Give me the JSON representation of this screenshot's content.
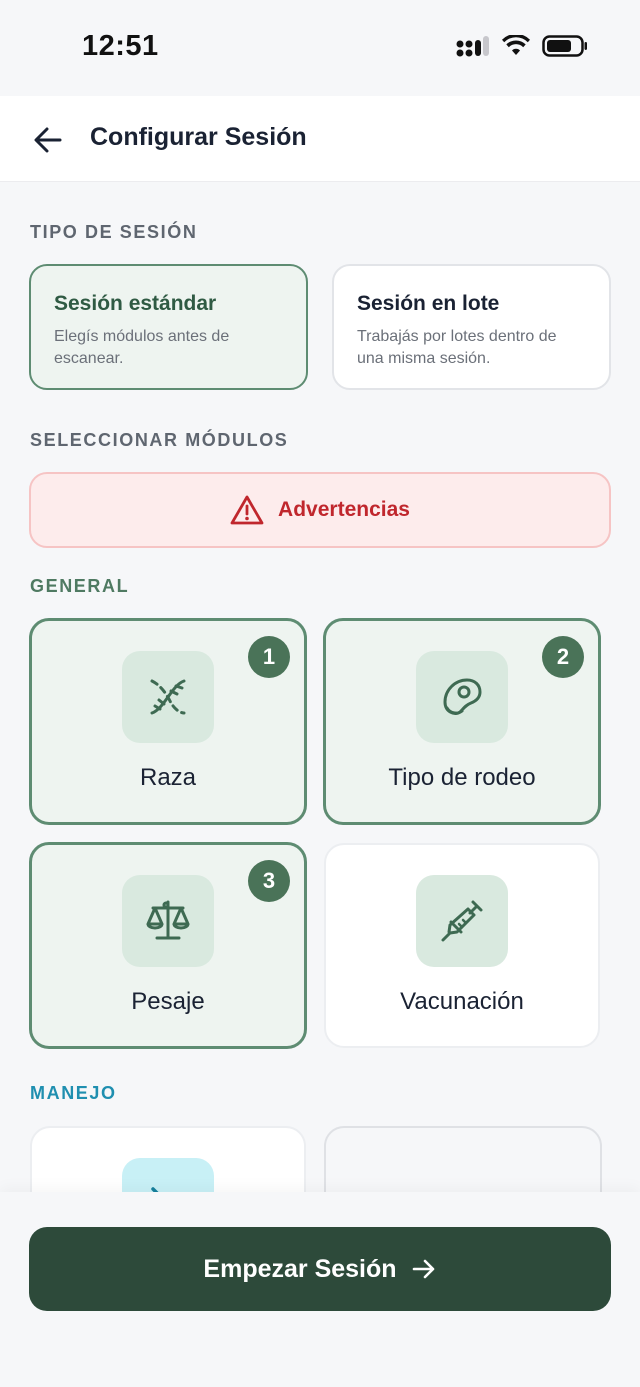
{
  "status_bar": {
    "time": "12:51"
  },
  "header": {
    "title": "Configurar Sesión",
    "back_icon": "arrow-left-icon"
  },
  "session_type": {
    "section_label": "TIPO DE SESIÓN",
    "options": [
      {
        "title": "Sesión estándar",
        "description": "Elegís módulos antes de escanear.",
        "selected": true
      },
      {
        "title": "Sesión en lote",
        "description": "Trabajás por lotes dentro de una misma sesión.",
        "selected": false
      }
    ]
  },
  "modules_section": {
    "label": "SELECCIONAR MÓDULOS"
  },
  "warning": {
    "label": "Advertencias",
    "icon": "warning-triangle-icon",
    "color": "#c0272d"
  },
  "groups": {
    "general": {
      "label": "GENERAL",
      "color": "#4f7a62",
      "modules": [
        {
          "label": "Raza",
          "icon": "dna-icon",
          "selected": true,
          "order": "1"
        },
        {
          "label": "Tipo de rodeo",
          "icon": "meat-steak-icon",
          "selected": true,
          "order": "2"
        },
        {
          "label": "Pesaje",
          "icon": "scale-icon",
          "selected": true,
          "order": "3"
        },
        {
          "label": "Vacunación",
          "icon": "syringe-icon",
          "selected": false
        }
      ]
    },
    "manejo": {
      "label": "MANEJO",
      "color": "#1f8fb0",
      "modules": [
        {
          "label": "",
          "icon": "tag-off-icon",
          "selected": false
        },
        {
          "label": "",
          "icon": "arrow-right-icon",
          "selected": false,
          "disabled": true
        }
      ]
    }
  },
  "cta": {
    "label": "Empezar Sesión",
    "icon": "arrow-right-icon"
  },
  "colors": {
    "primary": "#2d4a3a",
    "accent": "#5e8c72",
    "background": "#f6f7f9"
  }
}
